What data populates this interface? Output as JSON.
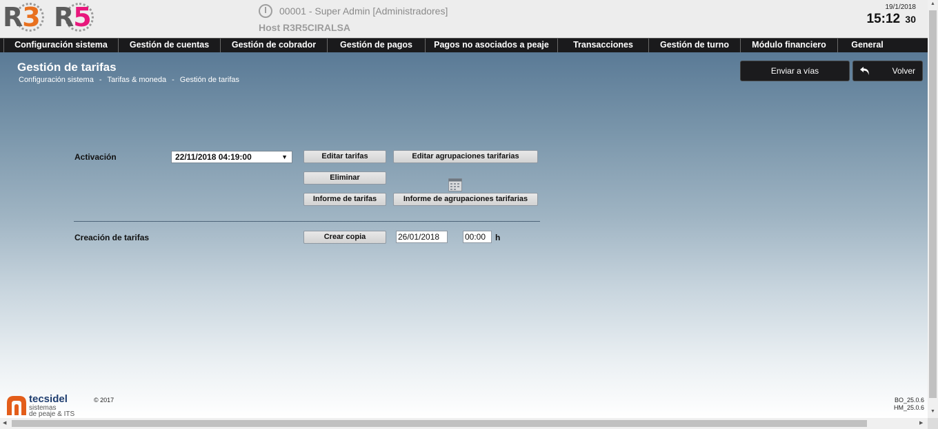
{
  "header": {
    "logo_r3": "R3",
    "logo_r5": "R5",
    "user": "00001 - Super Admin [Administradores]",
    "host": "Host R3R5CIRALSA",
    "date": "19/1/2018",
    "time": "15:12",
    "seconds": "30"
  },
  "nav": {
    "items": [
      "Configuración sistema",
      "Gestión de cuentas",
      "Gestión de cobrador",
      "Gestión de pagos",
      "Pagos no asociados a peaje",
      "Transacciones",
      "Gestión de turno",
      "Módulo financiero",
      "General"
    ]
  },
  "page": {
    "title": "Gestión de tarifas",
    "breadcrumb": [
      "Configuración sistema",
      "Tarifas & moneda",
      "Gestión de tarifas"
    ],
    "breadcrumb_sep": "-"
  },
  "actions": {
    "enviar": "Enviar a vías",
    "volver": "Volver"
  },
  "activation": {
    "label": "Activación",
    "selected": "22/11/2018 04:19:00",
    "buttons": {
      "editar_tarifas": "Editar tarifas",
      "editar_agrupaciones": "Editar agrupaciones tarifarias",
      "eliminar": "Eliminar",
      "informe_tarifas": "Informe de tarifas",
      "informe_agrupaciones": "Informe de agrupaciones tarifarias"
    }
  },
  "creation": {
    "label": "Creación de tarifas",
    "button": "Crear copia",
    "date": "26/01/2018",
    "time": "00:00",
    "time_unit": "h"
  },
  "footer": {
    "brand": "tecsidel",
    "tagline_1": "sistemas",
    "tagline_2": "de peaje & ITS",
    "copyright": "© 2017",
    "version_bo": "BO_25.0.6",
    "version_hm": "HM_25.0.6"
  },
  "colors": {
    "nav_bg": "#1a1a1c",
    "r3_orange": "#e8701f",
    "r5_pink": "#e8177c",
    "tecsidel_orange": "#e35d1a",
    "tecsidel_blue": "#1d3c6e"
  }
}
